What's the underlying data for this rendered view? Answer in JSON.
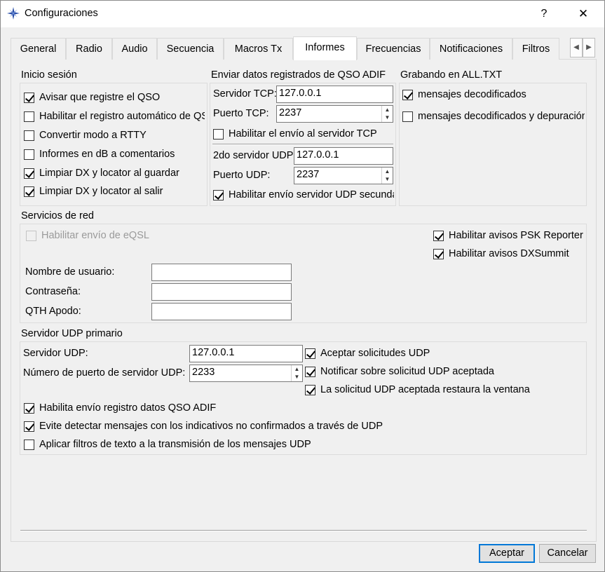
{
  "window": {
    "title": "Configuraciones",
    "help_glyph": "?",
    "close_glyph": "✕"
  },
  "tabs": [
    "General",
    "Radio",
    "Audio",
    "Secuencia",
    "Macros Tx",
    "Informes",
    "Frecuencias",
    "Notificaciones",
    "Filtros"
  ],
  "active_tab": "Informes",
  "inicio": {
    "title": "Inicio sesión",
    "items": [
      {
        "label": "Avisar que registre el QSO",
        "checked": true
      },
      {
        "label": "Habilitar el registro automático de QSO",
        "checked": false
      },
      {
        "label": "Convertir modo a RTTY",
        "checked": false
      },
      {
        "label": "Informes en dB a comentarios",
        "checked": false
      },
      {
        "label": "Limpiar DX y locator al guardar",
        "checked": true
      },
      {
        "label": "Limpiar DX y locator al salir",
        "checked": true
      }
    ]
  },
  "adif": {
    "title": "Enviar datos registrados de QSO ADIF",
    "tcp_server_label": "Servidor TCP:",
    "tcp_server_value": "127.0.0.1",
    "tcp_port_label": "Puerto TCP:",
    "tcp_port_value": "2237",
    "tcp_enable_label": "Habilitar el envío al servidor TCP",
    "tcp_enable_checked": false,
    "udp2_server_label": "2do servidor UDP",
    "udp2_server_value": "127.0.0.1",
    "udp_port_label": "Puerto UDP:",
    "udp_port_value": "2237",
    "udp2_enable_label": "Habilitar envío servidor UDP secundario",
    "udp2_enable_checked": true
  },
  "alltxt": {
    "title": "Grabando en ALL.TXT",
    "items": [
      {
        "label": "mensajes decodificados",
        "checked": true
      },
      {
        "label": "mensajes decodificados y depuración",
        "checked": false
      }
    ]
  },
  "red": {
    "title": "Servicios de red",
    "eqsl_label": "Habilitar envío de eQSL",
    "psk_label": "Habilitar avisos PSK Reporter",
    "psk_checked": true,
    "dxsummit_label": "Habilitar avisos DXSummit",
    "dxsummit_checked": true,
    "user_label": "Nombre de usuario:",
    "user_value": "",
    "pass_label": "Contraseña:",
    "pass_value": "",
    "qth_label": "QTH Apodo:",
    "qth_value": ""
  },
  "udp": {
    "title": "Servidor UDP primario",
    "server_label": "Servidor UDP:",
    "server_value": "127.0.0.1",
    "port_label": "Número de puerto de servidor UDP:",
    "port_value": "2233",
    "accept_label": "Aceptar solicitudes UDP",
    "accept_checked": true,
    "notify_label": "Notificar sobre solicitud UDP aceptada",
    "notify_checked": true,
    "restore_label": "La solicitud UDP aceptada restaura la ventana",
    "restore_checked": true,
    "adif_label": "Habilita envío registro datos QSO ADIF",
    "adif_checked": true,
    "avoid_label": "Evite detectar mensajes con los indicativos no confirmados a través de UDP",
    "avoid_checked": true,
    "filter_label": "Aplicar filtros de texto a la transmisión de los mensajes UDP",
    "filter_checked": false
  },
  "buttons": {
    "ok": "Aceptar",
    "cancel": "Cancelar"
  }
}
